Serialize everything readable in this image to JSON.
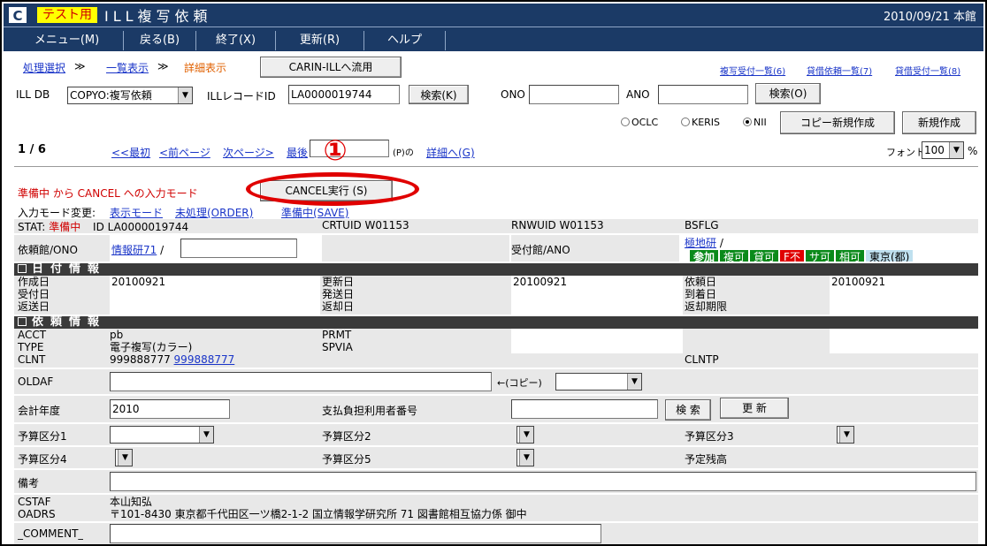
{
  "header": {
    "logo": "C",
    "badge": "テスト用",
    "title": "ILL複写依頼",
    "date_location": "2010/09/21 本館"
  },
  "menu": [
    {
      "label": "メニュー(M)"
    },
    {
      "label": "戻る(B)"
    },
    {
      "label": "終了(X)"
    },
    {
      "label": "更新(R)"
    },
    {
      "label": "ヘルプ"
    }
  ],
  "breadcrumb": {
    "step1": "処理選択",
    "sep": "≫",
    "step2": "一覧表示",
    "current": "詳細表示",
    "carin_button": "CARIN-ILLへ流用"
  },
  "top_links": {
    "link1": "複写受付一覧(6)",
    "link2": "貸借依頼一覧(7)",
    "link3": "貸借受付一覧(8)"
  },
  "search": {
    "illdb_label": "ILL DB",
    "illdb_value": "COPYO:複写依頼",
    "record_label": "ILLレコードID",
    "record_value": "LA0000019744",
    "search_button": "検索(K)",
    "ono_label": "ONO",
    "ono_value": "",
    "ano_label": "ANO",
    "ano_value": "",
    "search_button2": "検索(O)"
  },
  "sources": {
    "oclc": "OCLC",
    "keris": "KERIS",
    "nii": "NII",
    "copy_new_button": "コピー新規作成",
    "new_button": "新規作成"
  },
  "pager": {
    "position": "1 / 6",
    "first": "<<最初",
    "prev": "<前ページ",
    "next": "次ページ>",
    "last": "最後",
    "page_value": "",
    "page_suffix": "(P)の",
    "detail_link": "詳細へ(G)",
    "font_label": "フォント",
    "font_value": "100",
    "font_unit": "%"
  },
  "mode": {
    "message": "準備中 から CANCEL への入力モード",
    "cancel_button": "CANCEL実行 (S)",
    "change_label": "入力モード変更:",
    "display_mode": "表示モード",
    "unprocessed": "未処理(ORDER)",
    "preparing": "準備中(SAVE)"
  },
  "annotation": {
    "number": "①"
  },
  "record": {
    "stat_label": "STAT:",
    "stat_value": "準備中",
    "id_label": "ID",
    "id_value": "LA0000019744",
    "crtuid": "CRTUID W01153",
    "rnwuid": "RNWUID W01153",
    "bsflg": "BSFLG",
    "irai_label": "依頼館/ONO",
    "irai_link": "情報研71",
    "irai_sep": "/",
    "irai_value": "",
    "uketsuke_label": "受付館/ANO",
    "uke_link": "極地研",
    "uke_sep": "/",
    "badges": {
      "sanka": "参加",
      "fukuka": "複可",
      "taika": "貸可",
      "ffu": "F不",
      "saka": "サ可",
      "soka": "相可",
      "tokyo": "東京(都)"
    }
  },
  "dates": {
    "section_title": "日付情報",
    "created_label": "作成日",
    "created_value": "20100921",
    "updated_label": "更新日",
    "updated_value": "20100921",
    "requested_label": "依頼日",
    "requested_value": "20100921",
    "received_label": "受付日",
    "sent_label": "発送日",
    "arrived_label": "到着日",
    "returned_label": "返送日",
    "return_recv_label": "返却日",
    "return_due_label": "返却期限"
  },
  "request": {
    "section_title": "依頼情報",
    "acct_label": "ACCT",
    "acct_value": "pb",
    "prmt_label": "PRMT",
    "type_label": "TYPE",
    "type_value": "電子複写(カラー)",
    "spvia_label": "SPVIA",
    "clnt_label": "CLNT",
    "clnt_value": "999888777",
    "clnt_link": "999888777",
    "clntp_label": "CLNTP",
    "oldaf_label": "OLDAF",
    "oldaf_value": "",
    "copy_label": "←(コピー)",
    "copy_select": "",
    "fiscal_label": "会計年度",
    "fiscal_value": "2010",
    "payer_label": "支払負担利用者番号",
    "payer_value": "",
    "payer_search": "検 索",
    "payer_update": "更 新",
    "budget1_label": "予算区分1",
    "budget2_label": "予算区分2",
    "budget3_label": "予算区分3",
    "budget4_label": "予算区分4",
    "budget5_label": "予算区分5",
    "balance_label": "予定残高",
    "remarks_label": "備考",
    "remarks_value": "",
    "cstaf_label": "CSTAF",
    "cstaf_value": "本山知弘",
    "oadrs_label": "OADRS",
    "oadrs_value": "〒101-8430 東京都千代田区一ツ橋2-1-2 国立情報学研究所 71 図書館相互協力係 御中",
    "comment_label": "_COMMENT_",
    "comment_value": ""
  }
}
